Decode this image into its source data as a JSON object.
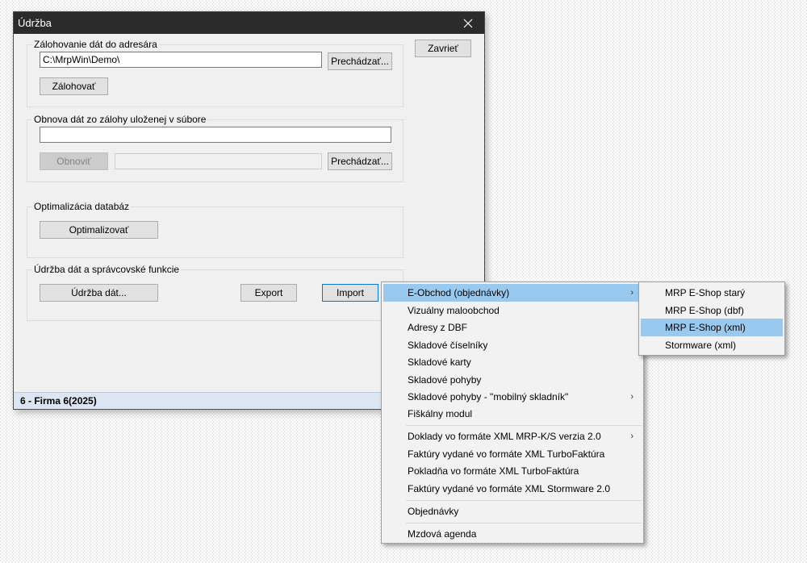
{
  "window": {
    "title": "Údržba",
    "close_label": "Zavrieť",
    "status": "6 - Firma 6(2025)"
  },
  "backup": {
    "label": "Zálohovanie dát do adresára",
    "path_value": "C:\\MrpWin\\Demo\\",
    "browse_label": "Prechádzať...",
    "backup_label": "Zálohovať"
  },
  "restore": {
    "label": "Obnova dát zo zálohy uloženej v súbore",
    "file_value": "",
    "restore_label": "Obnoviť",
    "browse_label": "Prechádzať..."
  },
  "optimize": {
    "label": "Optimalizácia databáz",
    "button_label": "Optimalizovať"
  },
  "maintenance": {
    "label": "Údržba dát a správcovské funkcie",
    "data_label": "Údržba dát...",
    "export_label": "Export",
    "import_label": "Import"
  },
  "menu": {
    "items": [
      "E-Obchod (objednávky)",
      "Vizuálny maloobchod",
      "Adresy z DBF",
      "Skladové číselníky",
      "Skladové karty",
      "Skladové pohyby",
      "Skladové pohyby - \"mobilný skladník\"",
      "Fiškálny modul",
      "Doklady vo formáte XML MRP-K/S verzia 2.0",
      "Faktúry vydané vo formáte XML TurboFaktúra",
      "Pokladňa vo formáte XML TurboFaktúra",
      "Faktúry vydané vo formáte XML Stormware 2.0",
      "Objednávky",
      "Mzdová agenda"
    ]
  },
  "submenu": {
    "items": [
      "MRP E-Shop starý",
      "MRP E-Shop (dbf)",
      "MRP E-Shop (xml)",
      "Stormware (xml)"
    ]
  },
  "icons": {
    "close": "close-icon",
    "submenu_arrow": "chevron-right-icon"
  },
  "colors": {
    "titlebar": "#2b2b2b",
    "highlight": "#99c9ef",
    "statusbar": "#dce6f2"
  }
}
